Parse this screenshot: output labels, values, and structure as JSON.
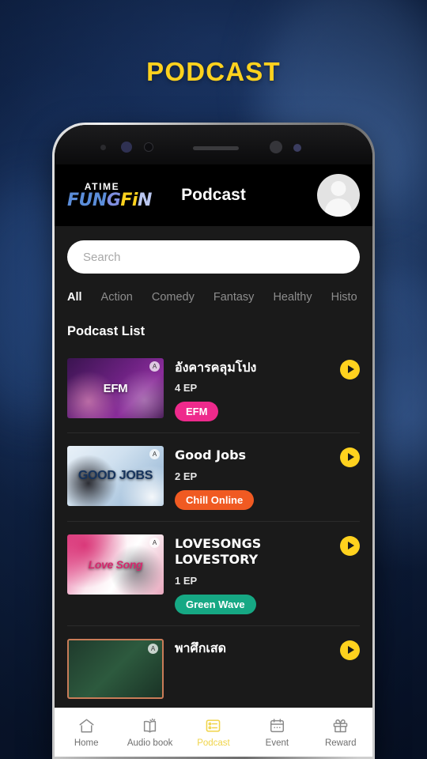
{
  "page": {
    "headline": "PODCAST",
    "background_color": "#12284f",
    "accent_color": "#ffd21e"
  },
  "app": {
    "logo": {
      "top": "ATIME",
      "bottom_parts": [
        "FUN",
        "G",
        "Fi",
        "N"
      ],
      "full": "ATIME FUNGFIN"
    },
    "title": "Podcast",
    "avatar_name": "user-avatar"
  },
  "search": {
    "placeholder": "Search",
    "value": ""
  },
  "categories": [
    {
      "label": "All",
      "active": true
    },
    {
      "label": "Action",
      "active": false
    },
    {
      "label": "Comedy",
      "active": false
    },
    {
      "label": "Fantasy",
      "active": false
    },
    {
      "label": "Healthy",
      "active": false
    },
    {
      "label": "Histo",
      "active": false
    }
  ],
  "list": {
    "section_title": "Podcast List",
    "items": [
      {
        "title": "อังคารคลุมโปง",
        "episodes": "4 EP",
        "channel": "EFM",
        "channel_color": "#ee2a8c",
        "thumb_text": "EFM",
        "thumb_style": "th-efm",
        "play_label": "play"
      },
      {
        "title": "Good Jobs",
        "episodes": "2 EP",
        "channel": "Chill Online",
        "channel_color": "#f05a22",
        "thumb_text": "GOOD JOBS",
        "thumb_style": "th-good",
        "play_label": "play"
      },
      {
        "title": "LOVESONGS LOVESTORY",
        "episodes": "1 EP",
        "channel": "Green Wave",
        "channel_color": "#16a884",
        "thumb_text": "Love Song",
        "thumb_style": "th-love",
        "play_label": "play"
      },
      {
        "title": "พาศึกเสด",
        "episodes": "",
        "channel": "",
        "channel_color": "#2d5a3e",
        "thumb_text": "",
        "thumb_style": "th-pha",
        "play_label": "play"
      }
    ]
  },
  "bottom_nav": [
    {
      "label": "Home",
      "icon": "home-icon",
      "active": false
    },
    {
      "label": "Audio book",
      "icon": "book-icon",
      "active": false
    },
    {
      "label": "Podcast",
      "icon": "podcast-list-icon",
      "active": true
    },
    {
      "label": "Event",
      "icon": "calendar-icon",
      "active": false
    },
    {
      "label": "Reward",
      "icon": "gift-icon",
      "active": false
    }
  ]
}
